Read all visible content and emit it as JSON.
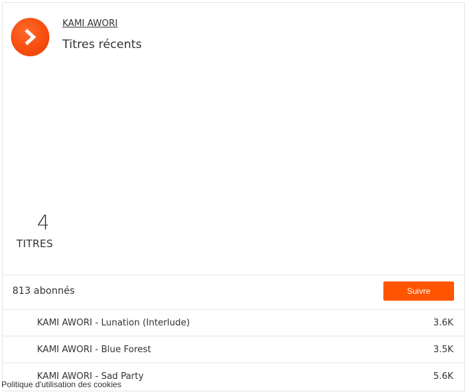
{
  "artist": {
    "name": "KAMI AWORI"
  },
  "playlist": {
    "title": "Titres récents"
  },
  "count": {
    "number": "4",
    "label": "TITRES"
  },
  "follow": {
    "followers": "813 abonnés",
    "button_label": "Suivre"
  },
  "tracks": [
    {
      "title": "KAMI AWORI - Lunation (Interlude)",
      "plays": "3.6K"
    },
    {
      "title": "KAMI AWORI - Blue Forest",
      "plays": "3.5K"
    },
    {
      "title": "KAMI AWORI - Sad Party",
      "plays": "5.6K"
    }
  ],
  "footer": {
    "cookie_policy": "Politique d'utilisation des cookies"
  },
  "colors": {
    "accent": "#ff5500",
    "logo": "#f84d10",
    "border": "#e5e5e5",
    "text": "#333333"
  },
  "icons": {
    "logo": "play-icon"
  }
}
